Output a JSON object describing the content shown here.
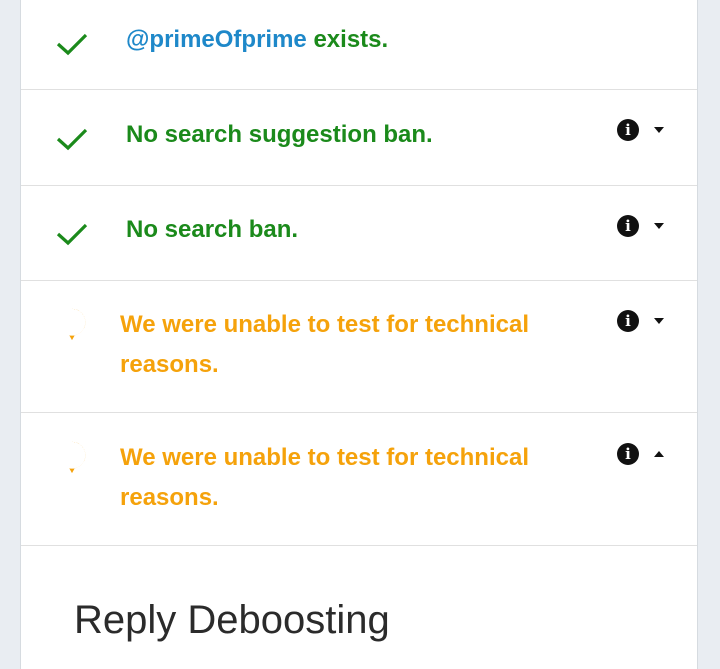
{
  "results": [
    {
      "status": "ok",
      "handle": "@primeOfprime",
      "text": " exists.",
      "info": false
    },
    {
      "status": "ok",
      "text": "No search suggestion ban.",
      "info": true,
      "caret": "down"
    },
    {
      "status": "ok",
      "text": "No search ban.",
      "info": true,
      "caret": "down"
    },
    {
      "status": "unknown",
      "text": "We were unable to test for technical reasons.",
      "info": true,
      "caret": "down"
    },
    {
      "status": "unknown",
      "text": "We were unable to test for technical reasons.",
      "info": true,
      "caret": "up"
    }
  ],
  "icons": {
    "ok": "checkmark-icon",
    "unknown": "question-bubble-icon",
    "info": "info-icon",
    "caret_down": "caret-down-icon",
    "caret_up": "caret-up-icon"
  },
  "info_glyph": "i",
  "section": {
    "title": "Reply Deboosting"
  },
  "colors": {
    "ok": "#1b8a1b",
    "warn": "#f5a20b",
    "handle": "#1e88c9"
  }
}
